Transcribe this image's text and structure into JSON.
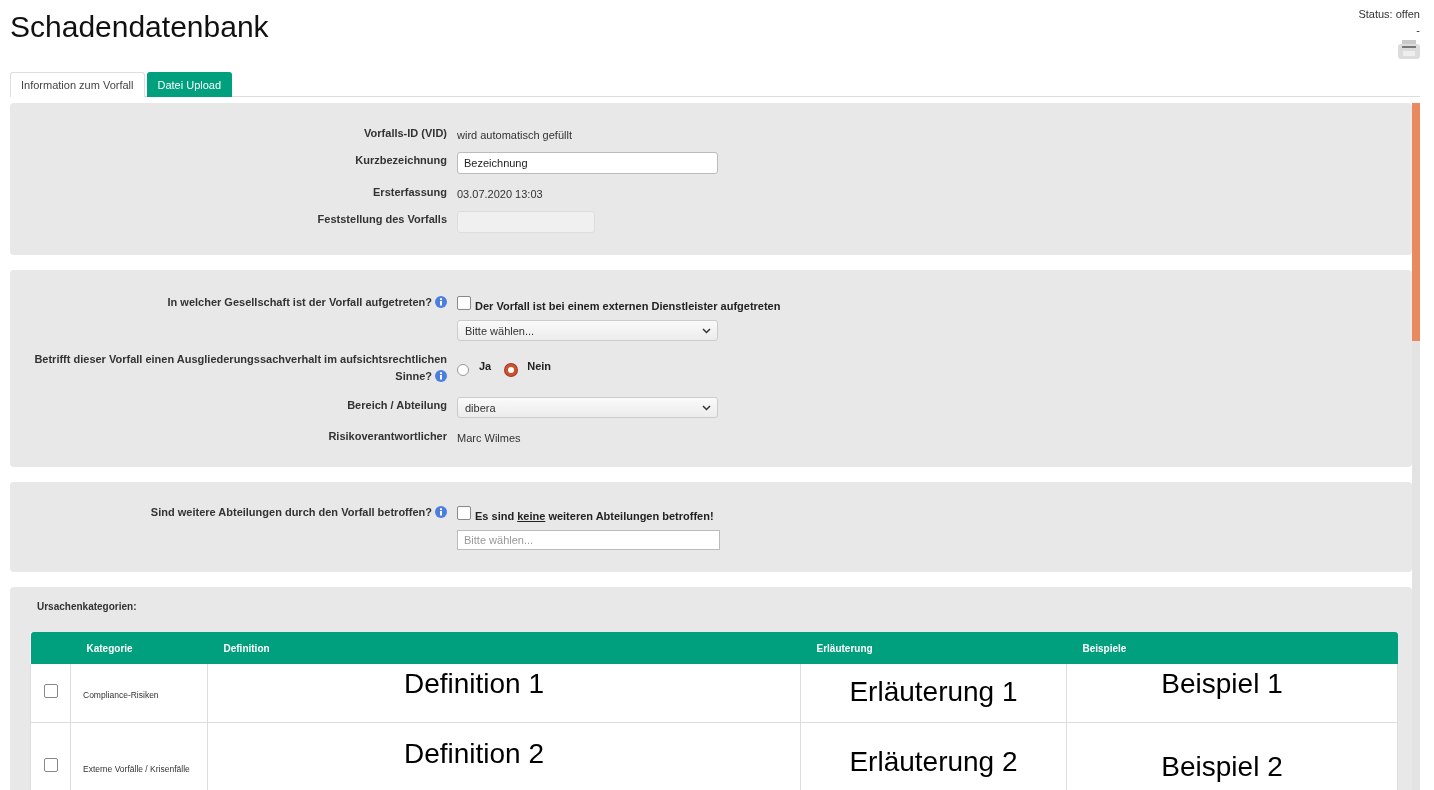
{
  "title": "Schadendatenbank",
  "status": {
    "label": "Status: offen",
    "sub": "-"
  },
  "tabs": [
    {
      "label": "Information zum Vorfall",
      "selected": true
    },
    {
      "label": "Datei Upload",
      "selected": false
    }
  ],
  "panels": [
    {
      "fields": [
        {
          "kind": "text",
          "label": "Vorfalls-ID (VID)",
          "value": "wird automatisch gefüllt"
        },
        {
          "kind": "input",
          "label": "Kurzbezeichnung",
          "value": "Bezeichnung",
          "disabled": false
        },
        {
          "kind": "text",
          "label": "Ersterfassung",
          "value": "03.07.2020 13:03"
        },
        {
          "kind": "input",
          "label": "Feststellung des Vorfalls",
          "disabled": true
        }
      ]
    },
    {
      "fields": [
        {
          "kind": "checkselect",
          "label": "In welcher Gesellschaft ist der Vorfall aufgetreten?",
          "info": true,
          "checkbox": {
            "before": "Der Vorfall ist bei einem externen Dienstleister aufgetreten",
            "checked": false
          },
          "select": "Bitte wählen..."
        },
        {
          "kind": "radio",
          "label": "Betrifft dieser Vorfall einen Ausgliederungssachverhalt im aufsichtsrechtlichen Sinne?",
          "info": true,
          "options": [
            {
              "label": "Ja",
              "selected": false
            },
            {
              "label": "Nein",
              "selected": true
            }
          ]
        },
        {
          "kind": "select",
          "label": "Bereich / Abteilung",
          "value": "dibera"
        },
        {
          "kind": "text",
          "label": "Risikoverantwortlicher",
          "value": "Marc Wilmes"
        }
      ]
    },
    {
      "fields": [
        {
          "kind": "checktags",
          "label": "Sind weitere Abteilungen durch den Vorfall betroffen?",
          "info": true,
          "checkbox": {
            "before": "Es sind ",
            "underlined": "keine",
            "after": " weiteren Abteilungen betroffen!",
            "checked": false
          },
          "placeholder": "Bitte wählen..."
        }
      ]
    }
  ],
  "categories": {
    "title": "Ursachenkategorien:",
    "columns": [
      "Kategorie",
      "Definition",
      "Erläuterung",
      "Beispiele"
    ],
    "rows": [
      {
        "checked": false,
        "category": "Compliance-Risiken",
        "definition": "Definition 1",
        "explanation": "Erläuterung 1",
        "example": "Beispiel 1"
      },
      {
        "checked": false,
        "category": "Externe Vorfälle / Krisenfälle",
        "definition": "Definition 2",
        "explanation": "Erläuterung 2",
        "example": "Beispiel 2"
      }
    ]
  }
}
